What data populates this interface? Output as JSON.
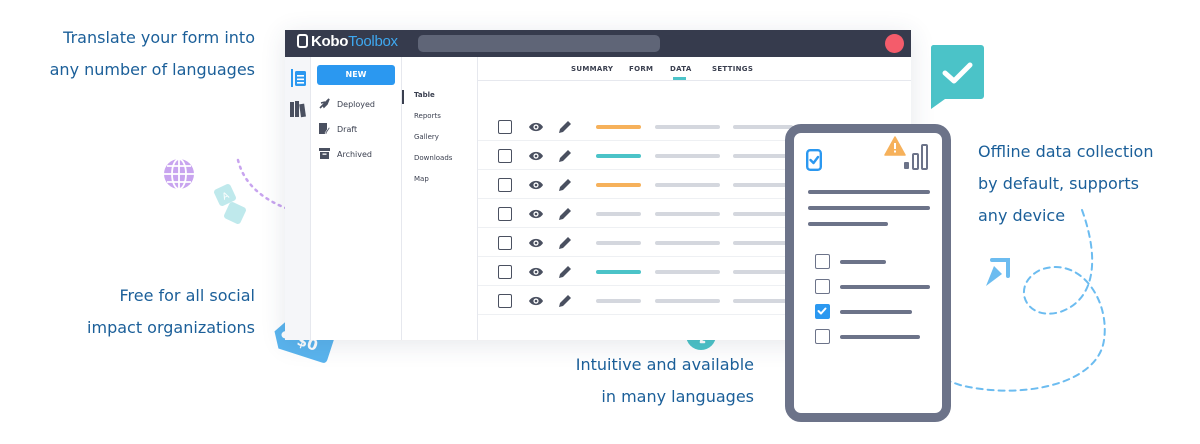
{
  "callouts": {
    "translate": [
      "Translate your form into",
      "any number of languages"
    ],
    "offline": [
      "Offline data collection",
      "by default, supports",
      "any device"
    ],
    "free": [
      "Free for all social",
      "impact organizations"
    ],
    "intuitive": [
      "Intuitive and available",
      "in many languages"
    ]
  },
  "price_tag": "$0",
  "app": {
    "logo_bold": "Kobo",
    "logo_light": "Toolbox",
    "new_button": "NEW",
    "sidebar": [
      {
        "label": "Deployed",
        "icon": "rocket-icon"
      },
      {
        "label": "Draft",
        "icon": "draft-icon"
      },
      {
        "label": "Archived",
        "icon": "archive-icon"
      }
    ],
    "subnav": [
      "Table",
      "Reports",
      "Gallery",
      "Downloads",
      "Map"
    ],
    "tabs": [
      "SUMMARY",
      "FORM",
      "DATA",
      "SETTINGS"
    ],
    "active_tab": "DATA",
    "row_status_colors": [
      "#f6b15b",
      "#4bc3c8",
      "#f6b15b",
      "#d4d7de",
      "#d4d7de",
      "#4bc3c8",
      "#d4d7de"
    ]
  },
  "colors": {
    "accent_blue": "#2b98f0",
    "teal": "#4bc3c8",
    "orange": "#f6b15b",
    "navy_text": "#1b5f99",
    "purple": "#c8a4ef",
    "danger": "#f45c6b"
  }
}
